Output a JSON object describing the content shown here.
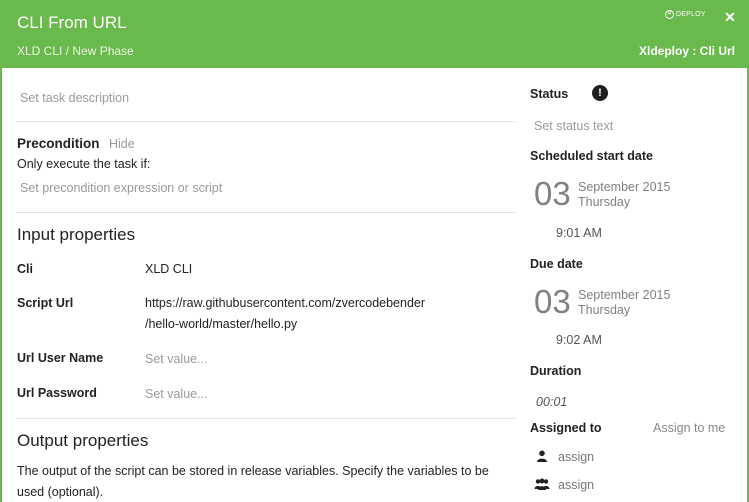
{
  "header": {
    "title": "CLI From URL",
    "breadcrumb": "XLD CLI / New Phase",
    "plugin": "Xldeploy : Cli Url",
    "logo_text": "DEPLOY",
    "close_glyph": "✕"
  },
  "main": {
    "description_placeholder": "Set task description",
    "precondition": {
      "title": "Precondition",
      "hide_label": "Hide",
      "subtitle": "Only execute the task if:",
      "placeholder": "Set precondition expression or script"
    },
    "input_properties": {
      "title": "Input properties",
      "cli_label": "Cli",
      "cli_value": "XLD CLI",
      "script_url_label": "Script Url",
      "script_url_line1": "https://raw.githubusercontent.com/zvercodebender",
      "script_url_line2": "/hello-world/master/hello.py",
      "user_label": "Url User Name",
      "user_placeholder": "Set value...",
      "password_label": "Url Password",
      "password_placeholder": "Set value..."
    },
    "output_properties": {
      "title": "Output properties",
      "description": "The output of the script can be stored in release variables. Specify the variables to be used (optional)."
    }
  },
  "sidebar": {
    "status_label": "Status",
    "status_icon": "exclamation-circle-icon",
    "status_glyph": "!",
    "status_placeholder": "Set status text",
    "scheduled": {
      "label": "Scheduled start date",
      "day": "03",
      "month_year": "September 2015",
      "weekday": "Thursday",
      "time": "9:01 AM"
    },
    "due": {
      "label": "Due date",
      "day": "03",
      "month_year": "September 2015",
      "weekday": "Thursday",
      "time": "9:02 AM"
    },
    "duration": {
      "label": "Duration",
      "value": "00:01"
    },
    "assigned": {
      "label": "Assigned to",
      "assign_to_me": "Assign to me",
      "user_assign": "assign",
      "team_assign": "assign"
    }
  },
  "colors": {
    "brand_green": "#69b94d"
  }
}
